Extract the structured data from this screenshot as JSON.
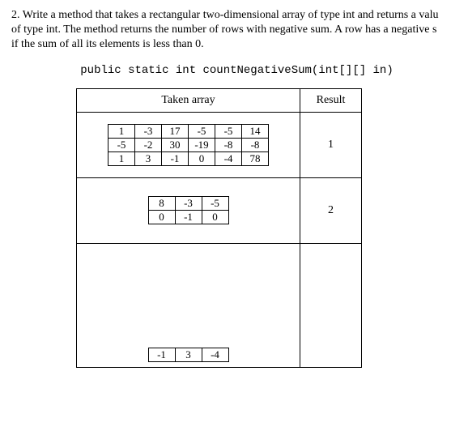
{
  "problem": {
    "num": "2.",
    "line1": "Write a method that takes a rectangular two-dimensional array of type int and returns a valu",
    "line2": "of type int. The method returns the number of rows with negative sum. A row has a negative s",
    "line3": "if the sum of all its elements is less than 0."
  },
  "code": "public static int countNegativeSum(int[][] in)",
  "headers": {
    "taken": "Taken array",
    "result": "Result"
  },
  "ex1": {
    "r0c0": "1",
    "r0c1": "-3",
    "r0c2": "17",
    "r0c3": "-5",
    "r0c4": "-5",
    "r0c5": "14",
    "r1c0": "-5",
    "r1c1": "-2",
    "r1c2": "30",
    "r1c3": "-19",
    "r1c4": "-8",
    "r1c5": "-8",
    "r2c0": "1",
    "r2c1": "3",
    "r2c2": "-1",
    "r2c3": "0",
    "r2c4": "-4",
    "r2c5": "78",
    "result": "1"
  },
  "ex2": {
    "r0c0": "8",
    "r0c1": "-3",
    "r0c2": "-5",
    "r1c0": "0",
    "r1c1": "-1",
    "r1c2": "0",
    "result": "2"
  },
  "ex3": {
    "r0c0": "-1",
    "r0c1": "3",
    "r0c2": "-4",
    "result": ""
  },
  "chart_data": {
    "type": "table",
    "examples": [
      {
        "array": [
          [
            1,
            -3,
            17,
            -5,
            -5,
            14
          ],
          [
            -5,
            -2,
            30,
            -19,
            -8,
            -8
          ],
          [
            1,
            3,
            -1,
            0,
            -4,
            78
          ]
        ],
        "result": 1
      },
      {
        "array": [
          [
            8,
            -3,
            -5
          ],
          [
            0,
            -1,
            0
          ]
        ],
        "result": 2
      },
      {
        "array": [
          [
            -1,
            3,
            -4
          ]
        ],
        "result": null
      }
    ]
  }
}
